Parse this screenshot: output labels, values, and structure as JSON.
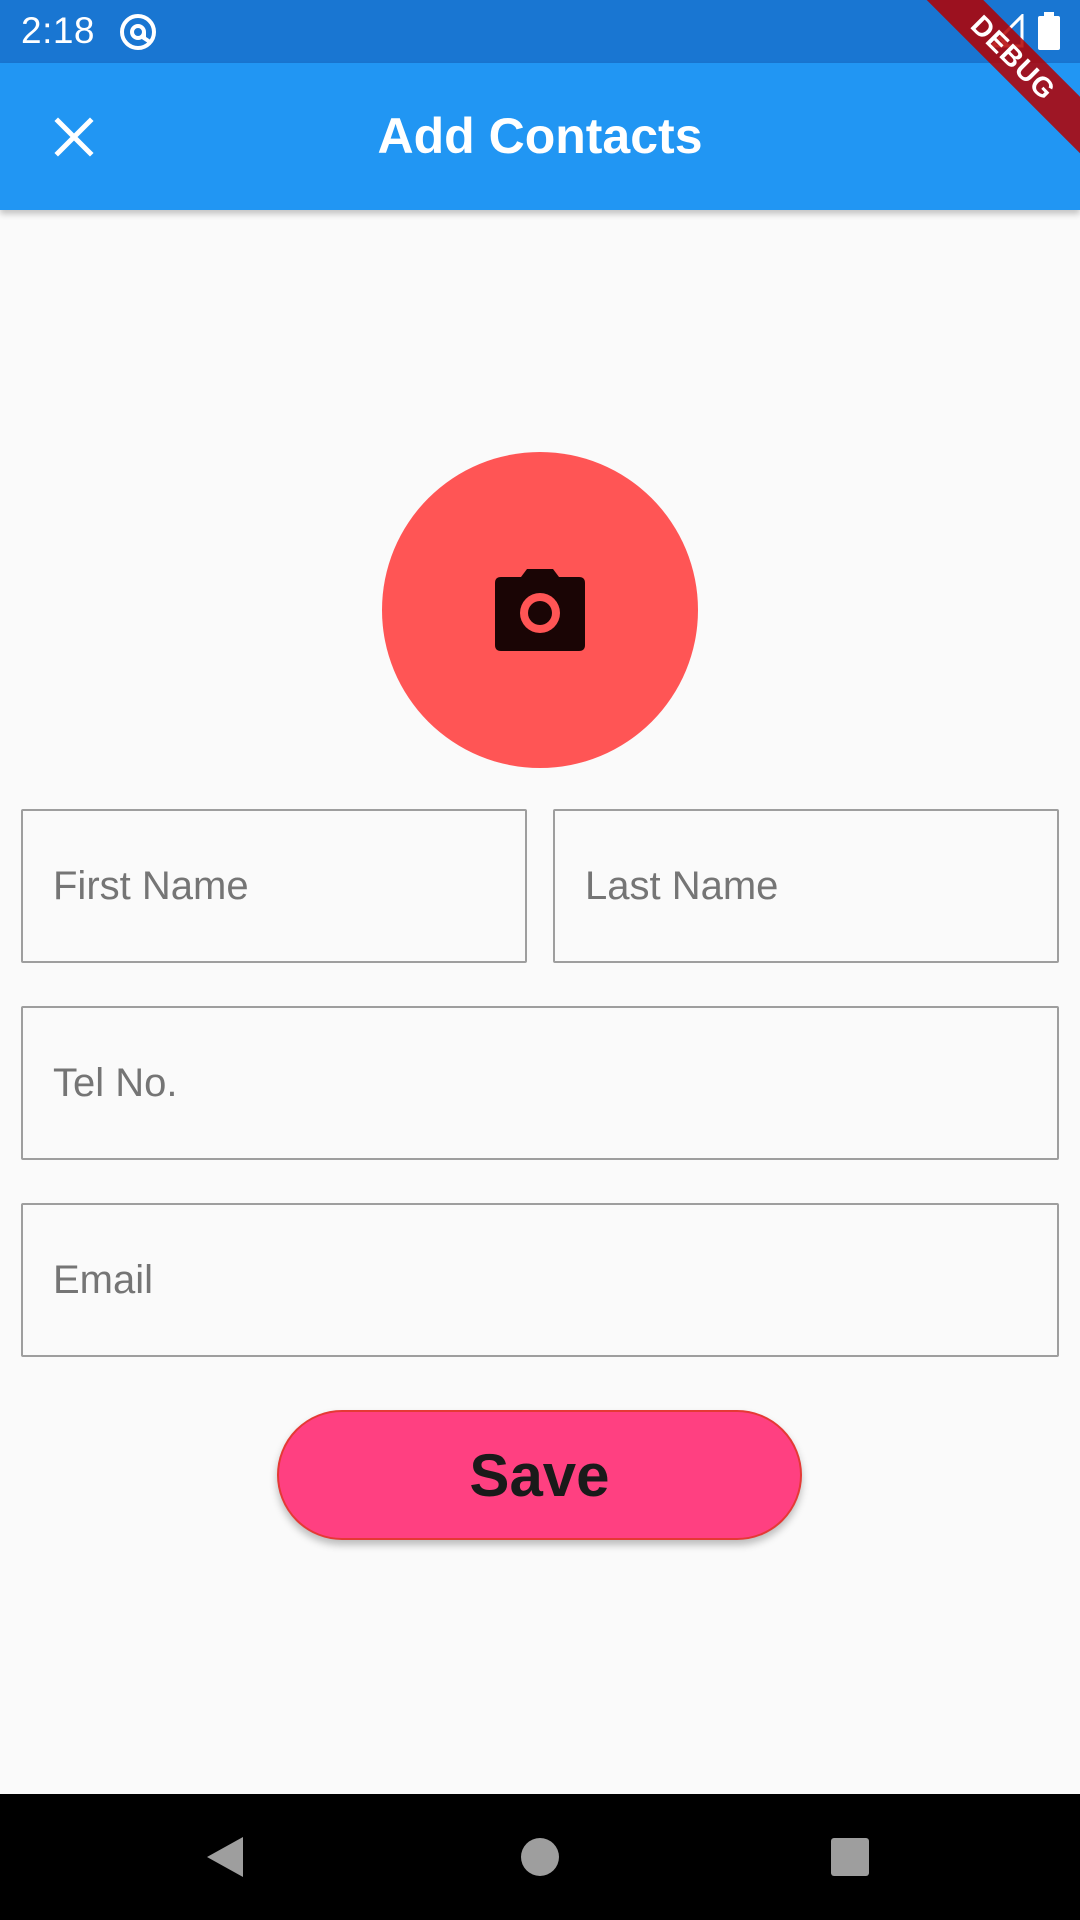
{
  "status_bar": {
    "time": "2:18",
    "app_icon": "at-sign-icon",
    "signal_icon": "signal-icon",
    "battery_icon": "battery-icon",
    "background_color": "#1976d2"
  },
  "app_bar": {
    "title": "Add Contacts",
    "close_icon": "close-icon",
    "background_color": "#2196f3"
  },
  "debug_banner": {
    "label": "DEBUG"
  },
  "avatar": {
    "icon": "camera-icon",
    "background_color": "#ff5555"
  },
  "form": {
    "first_name": {
      "placeholder": "First Name",
      "value": ""
    },
    "last_name": {
      "placeholder": "Last Name",
      "value": ""
    },
    "tel": {
      "placeholder": "Tel No.",
      "value": ""
    },
    "email": {
      "placeholder": "Email",
      "value": ""
    },
    "save_label": "Save",
    "save_color": "#ff4081"
  },
  "nav_bar": {
    "back_icon": "back-triangle-icon",
    "home_icon": "home-circle-icon",
    "recents_icon": "recents-square-icon"
  }
}
